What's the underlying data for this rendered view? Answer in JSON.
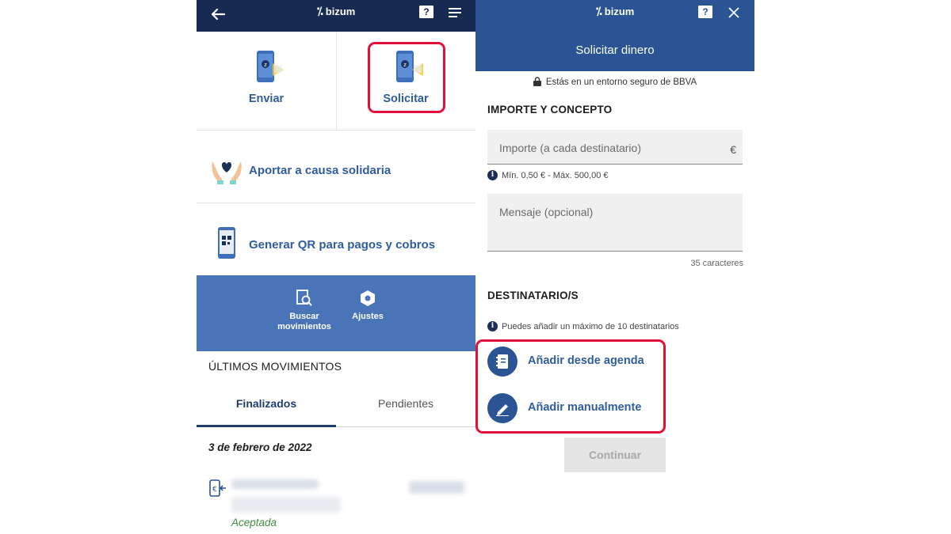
{
  "left_screen": {
    "header": {
      "brand": "bizum",
      "help_glyph": "?"
    },
    "actions": [
      {
        "label": "Enviar"
      },
      {
        "label": "Solicitar"
      }
    ],
    "options": [
      {
        "label": "Aportar a causa solidaria",
        "icon": "solidarity-hands-icon"
      },
      {
        "label": "Generar QR para pagos y cobros",
        "icon": "qr-phone-icon"
      }
    ],
    "toolbar": {
      "search_label": "Buscar movimientos",
      "settings_label": "Ajustes"
    },
    "movements": {
      "title": "ÚLTIMOS MOVIMIENTOS",
      "tabs": [
        "Finalizados",
        "Pendientes"
      ],
      "active_tab": "Finalizados",
      "date": "3 de febrero de 2022",
      "items": [
        {
          "status": "Aceptada"
        }
      ]
    }
  },
  "right_screen": {
    "header": {
      "brand": "bizum",
      "help_glyph": "?",
      "title": "Solicitar dinero"
    },
    "secure_notice": "Estás en un entorno seguro de BBVA",
    "amount_section": {
      "title": "IMPORTE Y CONCEPTO",
      "amount_placeholder": "Importe (a cada destinatario)",
      "currency": "€",
      "limits": "Mín. 0,50 € - Máx. 500,00 €",
      "message_placeholder": "Mensaje (opcional)",
      "char_counter": "35 caracteres"
    },
    "recipients_section": {
      "title": "DESTINATARIO/S",
      "info": "Puedes añadir un máximo de 10 destinatarios",
      "add_from_contacts": "Añadir desde agenda",
      "add_manually": "Añadir manualmente"
    },
    "continue_label": "Continuar"
  },
  "colors": {
    "header_dark": "#162a52",
    "header_blue": "#2b5494",
    "link_blue": "#2f5d9e",
    "band_blue": "#4a74b8",
    "highlight_red": "#e0103b",
    "accepted_green": "#3f8a3f"
  }
}
